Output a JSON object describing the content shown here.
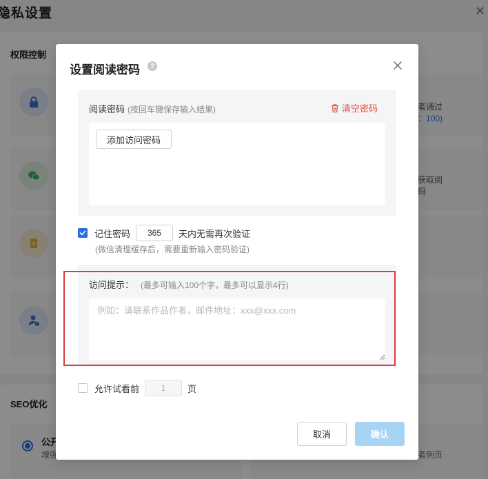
{
  "background": {
    "title": "隐私设置",
    "section_permission": "权限控制",
    "row1_text_a": "者通过",
    "row1_text_b_prefix": "：",
    "row1_text_b_value": "100)",
    "row2_text_a": "获取阅",
    "row2_text_b": "码",
    "section_seo": "SEO优化",
    "seo_option_label": "公开",
    "seo_option_desc": "增强",
    "seo_option_desc2": "者例页",
    "colors": {
      "radio": "#2b6fe0",
      "link": "#2f7dd9"
    }
  },
  "modal": {
    "title": "设置阅读密码",
    "password_section": {
      "label": "阅读密码",
      "hint": "(按回车键保存输入结果)",
      "clear_label": "清空密码",
      "add_button_label": "添加访问密码"
    },
    "remember": {
      "checked": true,
      "label": "记住密码",
      "days_value": "365",
      "suffix": "天内无需再次验证",
      "note": "(微信清理缓存后，需要重新输入密码验证)"
    },
    "access_hint": {
      "label": "访问提示：",
      "sub": "(最多可输入100个字，最多可以显示4行)",
      "placeholder": "例如：请联系作品作者，邮件地址：xxx@xxx.com",
      "value": ""
    },
    "trial": {
      "checked": false,
      "label": "允许试看前",
      "pages_value": "1",
      "suffix": "页"
    },
    "cancel_label": "取消",
    "confirm_label": "确认",
    "colors": {
      "primary": "#2b6fe0",
      "danger": "#e84c3d",
      "confirm_disabled": "#a7d3f5",
      "highlight_box": "#e03a3e"
    }
  }
}
